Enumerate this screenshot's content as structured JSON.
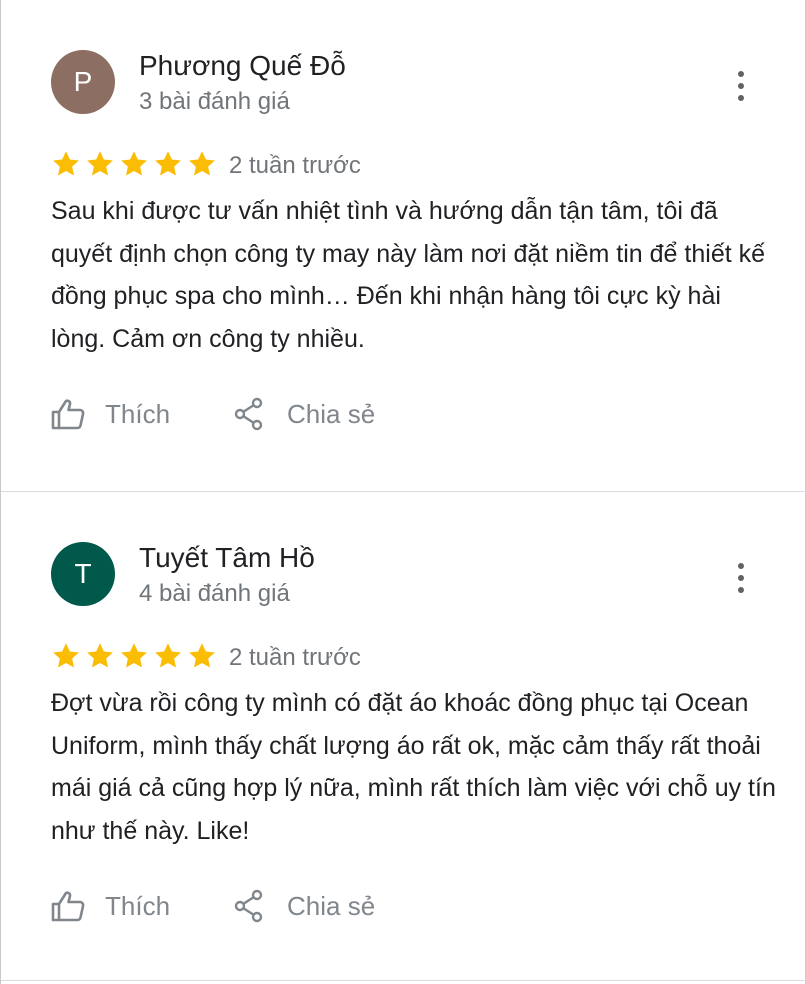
{
  "reviews": [
    {
      "avatar_letter": "P",
      "avatar_color": "#8d6e63",
      "name": "Phương Quế Đỗ",
      "review_count": "3 bài đánh giá",
      "rating": 5,
      "time": "2 tuần trước",
      "text": "Sau khi được tư vấn nhiệt tình và hướng dẫn tận tâm, tôi đã quyết định chọn công ty may này làm nơi đặt niềm tin để thiết kế đồng phục spa cho mình… Đến khi nhận hàng tôi cực kỳ hài lòng. Cảm ơn công ty nhiều.",
      "like_label": "Thích",
      "share_label": "Chia sẻ"
    },
    {
      "avatar_letter": "T",
      "avatar_color": "#00594a",
      "name": "Tuyết Tâm Hồ",
      "review_count": "4 bài đánh giá",
      "rating": 5,
      "time": "2 tuần trước",
      "text": "Đợt vừa rồi công ty mình có đặt áo khoác đồng phục tại Ocean Uniform, mình thấy chất lượng áo rất ok, mặc cảm thấy rất thoải mái giá cả cũng hợp lý nữa, mình rất thích làm việc với chỗ uy tín như thế này. Like!",
      "like_label": "Thích",
      "share_label": "Chia sẻ"
    }
  ],
  "colors": {
    "star": "#fbbc04",
    "secondary_text": "#70757a",
    "action_text": "#80868b",
    "divider": "#dadce0"
  },
  "icons": {
    "like": "thumb-up-outline-icon",
    "share": "share-icon",
    "menu": "more-vert-icon",
    "star": "star-icon"
  }
}
